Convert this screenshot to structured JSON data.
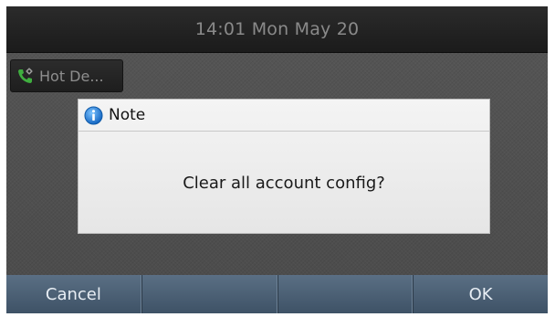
{
  "status_bar": {
    "time": "14:01 Mon May 20"
  },
  "account": {
    "label": "Hot De...",
    "icon": "phone-settings-icon"
  },
  "dialog": {
    "icon": "info-icon",
    "title": "Note",
    "message": "Clear all account config?"
  },
  "softkeys": [
    {
      "label": "Cancel"
    },
    {
      "label": ""
    },
    {
      "label": ""
    },
    {
      "label": "OK"
    }
  ],
  "colors": {
    "softkey_bg": "#4b6075",
    "dialog_bg": "#ececec",
    "info_icon": "#1e7fd8",
    "account_icon": "#3fae3f"
  }
}
